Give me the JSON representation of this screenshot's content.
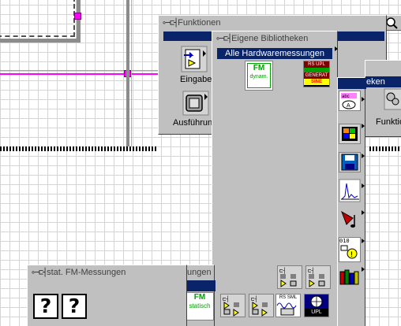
{
  "functions_palette": {
    "title": "Funktionen",
    "item_input": "Eingabe",
    "item_execution": "Ausführun"
  },
  "right_palette": {
    "header": "eken",
    "item_functions": "Funktio"
  },
  "own_libraries_palette": {
    "title": "Eigene Bibliotheken",
    "selected_item": "Alle Hardwaremessungen",
    "fm_icon_text": "FM",
    "fm_icon_subtext": "dynam.",
    "rs_icon_line1": "RS UPL",
    "rs_icon_line3": "GENERAT",
    "rs_icon_line4": "SINE"
  },
  "bottom_palette": {
    "title": "stat. FM-Messungen",
    "behind_header": "ungen",
    "fm_static_text": "FM",
    "fm_static_sub": "statisch",
    "rs_label": "RS SML",
    "upl_label": "UPL",
    "unknown_vi_1": "?",
    "unknown_vi_2": "?"
  },
  "icons": {
    "pin": "pushpin-icon",
    "search": "search-icon",
    "question": "unknown-vi-icon",
    "exclamation": "warning-icon"
  }
}
